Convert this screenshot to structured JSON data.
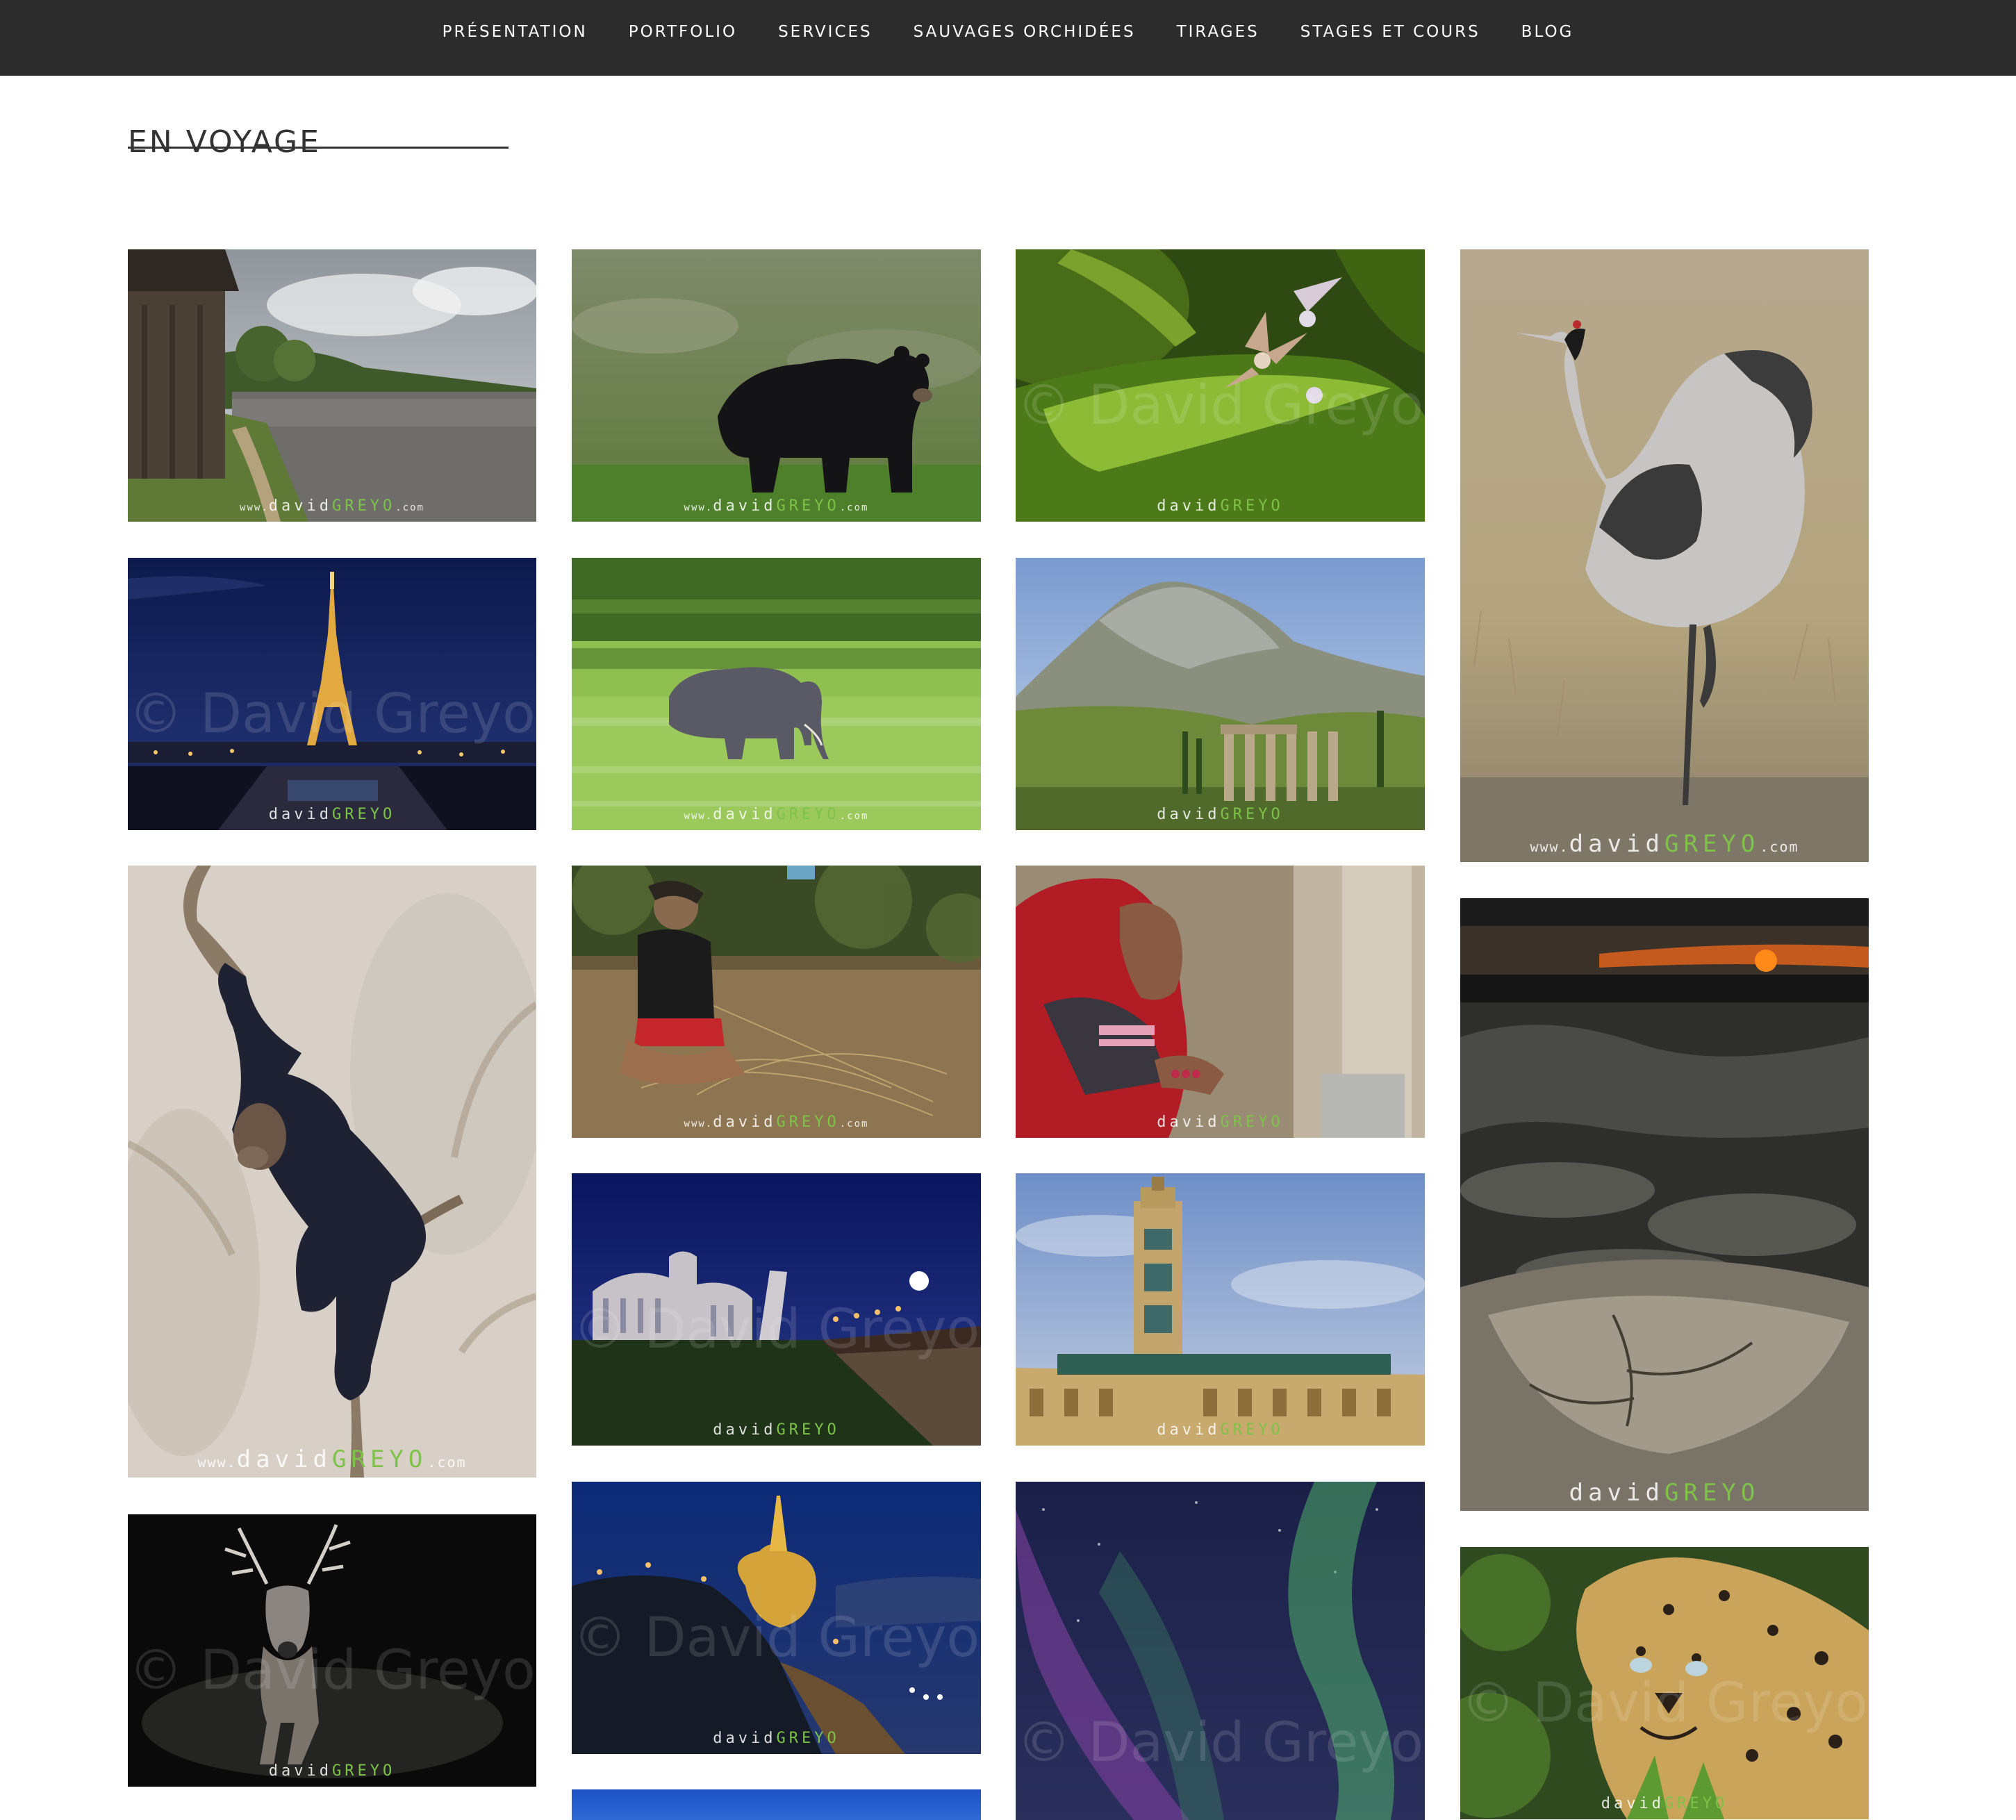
{
  "nav": {
    "items": [
      {
        "label": "PRÉSENTATION"
      },
      {
        "label": "PORTFOLIO"
      },
      {
        "label": "SERVICES"
      },
      {
        "label": "SAUVAGES ORCHIDÉES"
      },
      {
        "label": "TIRAGES"
      },
      {
        "label": "STAGES ET COURS"
      },
      {
        "label": "BLOG"
      }
    ]
  },
  "page": {
    "title": "EN VOYAGE"
  },
  "watermark": {
    "prefix": "www.",
    "name": "david",
    "accent": "GREYO",
    "suffix": ".com",
    "copyright": "© David Greyo"
  },
  "gallery": {
    "photos": [
      {
        "subject": "river-village",
        "icon": "river-landscape-photo"
      },
      {
        "subject": "black-bear",
        "icon": "bear-photo"
      },
      {
        "subject": "orchid",
        "icon": "orchid-photo"
      },
      {
        "subject": "common-crane",
        "icon": "crane-photo"
      },
      {
        "subject": "eiffel-tower-night",
        "icon": "eiffel-tower-photo"
      },
      {
        "subject": "elephant-motion",
        "icon": "elephant-photo"
      },
      {
        "subject": "mountain-temple-ruins",
        "icon": "ruins-photo"
      },
      {
        "subject": "chimpanzee",
        "icon": "chimpanzee-photo"
      },
      {
        "subject": "basket-weaver",
        "icon": "weaver-photo"
      },
      {
        "subject": "woman-in-red-sari",
        "icon": "portrait-photo"
      },
      {
        "subject": "sunset-volcanic-rocks",
        "icon": "sunset-photo"
      },
      {
        "subject": "pisa-night",
        "icon": "pisa-photo"
      },
      {
        "subject": "mosque-minaret",
        "icon": "mosque-photo"
      },
      {
        "subject": "red-deer-stag",
        "icon": "deer-photo"
      },
      {
        "subject": "golden-rock-pagoda",
        "icon": "pagoda-photo"
      },
      {
        "subject": "aurora-borealis",
        "icon": "aurora-photo"
      },
      {
        "subject": "leopard",
        "icon": "leopard-photo"
      },
      {
        "subject": "blue-sky-partial",
        "icon": "sky-photo"
      }
    ]
  },
  "colors": {
    "header_bg": "#2c2c2c",
    "title_text": "#333333",
    "watermark_accent": "#7fc24a"
  }
}
